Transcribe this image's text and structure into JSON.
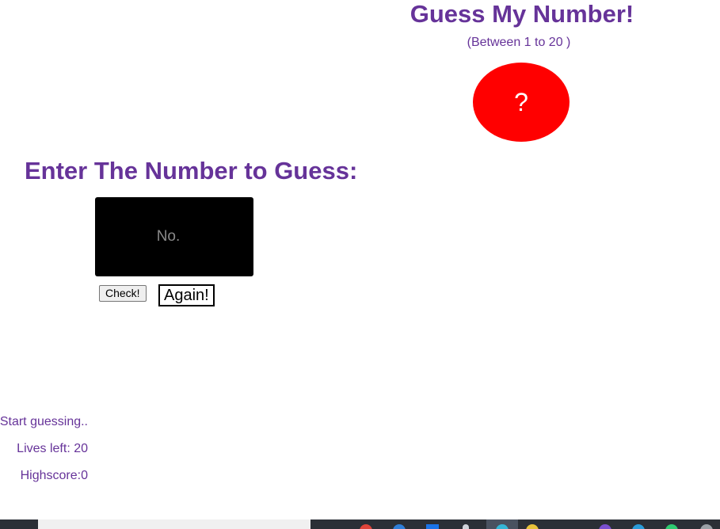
{
  "header": {
    "title": "Guess My Number!",
    "subtitle": "(Between 1 to 20 )",
    "secret_placeholder": "?"
  },
  "guess": {
    "heading": "Enter The Number to Guess:",
    "input_placeholder": "No.",
    "input_value": "",
    "check_label": "Check!",
    "again_label": "Again!"
  },
  "status": {
    "message": "Start guessing..",
    "lives": "Lives left: 20",
    "highscore": "Highscore:0"
  },
  "colors": {
    "accent": "#663399",
    "secret_bg": "#ff0000",
    "input_bg": "#000000"
  },
  "taskbar": {
    "icons": [
      "chrome-icon",
      "edge-icon",
      "store-icon",
      "explorer-icon",
      "app-icon",
      "folder-icon",
      "teams-icon",
      "browser-icon",
      "whatsapp-icon",
      "app-icon"
    ]
  }
}
